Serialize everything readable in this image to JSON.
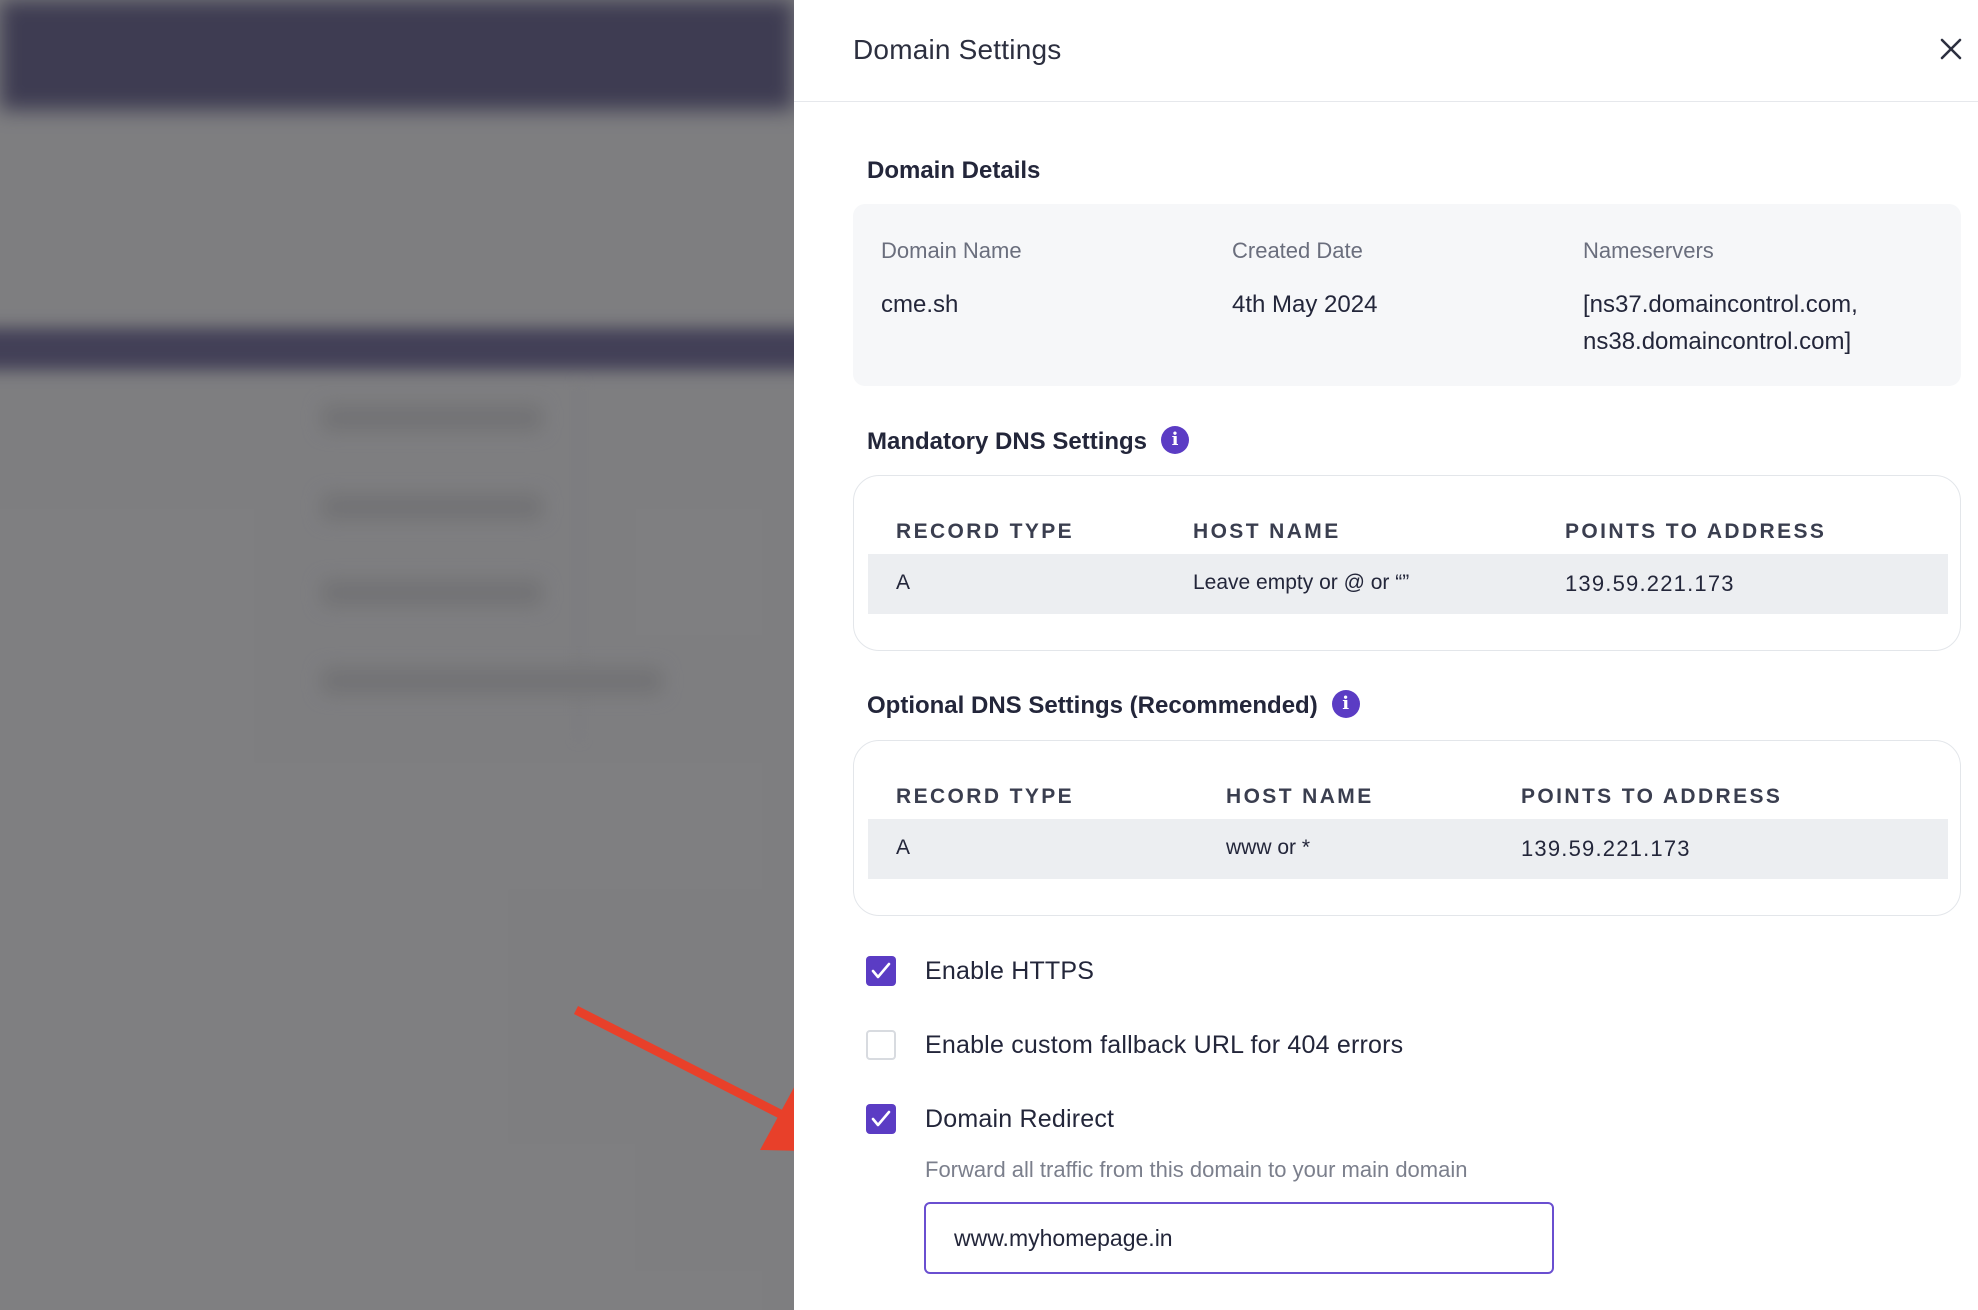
{
  "drawer": {
    "title": "Domain Settings"
  },
  "domain_details": {
    "title": "Domain Details",
    "domain_name_label": "Domain Name",
    "domain_name_value": "cme.sh",
    "created_date_label": "Created Date",
    "created_date_value": "4th May 2024",
    "nameservers_label": "Nameservers",
    "nameservers_value": "[ns37.domaincontrol.com,\nns38.domaincontrol.com]"
  },
  "mandatory_dns": {
    "title": "Mandatory DNS Settings",
    "headers": {
      "record_type": "RECORD TYPE",
      "host_name": "HOST NAME",
      "points_to": "POINTS TO ADDRESS"
    },
    "row": {
      "record_type": "A",
      "host_name": "Leave empty or @ or “”",
      "points_to": "139.59.221.173"
    }
  },
  "optional_dns": {
    "title": "Optional DNS Settings (Recommended)",
    "headers": {
      "record_type": "RECORD TYPE",
      "host_name": "HOST NAME",
      "points_to": "POINTS TO ADDRESS"
    },
    "row": {
      "record_type": "A",
      "host_name": "www or *",
      "points_to": "139.59.221.173"
    }
  },
  "options": {
    "https_label": "Enable HTTPS",
    "https_checked": true,
    "fallback_label": "Enable custom fallback URL for 404 errors",
    "fallback_checked": false,
    "redirect_label": "Domain Redirect",
    "redirect_checked": true,
    "redirect_helper": "Forward all traffic from this domain to your main domain",
    "redirect_value": "www.myhomepage.in"
  },
  "icons": {
    "close": "close-icon",
    "info": "info-icon",
    "check": "checkmark-icon",
    "annotation": "red-arrow-annotation"
  },
  "colors": {
    "accent": "#5b3cc4",
    "annotation": "#e8402a",
    "backdrop_nav": "#1b1838"
  }
}
